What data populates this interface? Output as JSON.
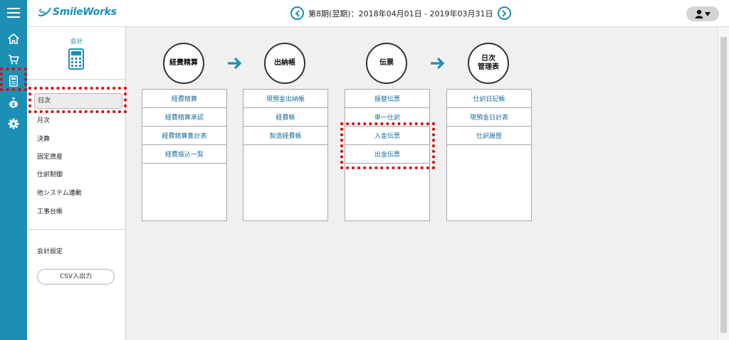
{
  "app": {
    "logo_text": "SmileWorks"
  },
  "header": {
    "period": "第8期(翌期)：2018年04月01日 - 2019年03月31日"
  },
  "rail": {
    "icons": [
      "menu-icon",
      "home-icon",
      "cart-icon",
      "calculator-icon",
      "yen-bag-icon",
      "gear-icon"
    ]
  },
  "sidebar": {
    "title": "会計",
    "items": [
      {
        "label": "日次",
        "active": true
      },
      {
        "label": "月次"
      },
      {
        "label": "決算"
      },
      {
        "label": "固定資産"
      },
      {
        "label": "仕訳制御"
      },
      {
        "label": "他システム連動"
      },
      {
        "label": "工事台帳"
      }
    ],
    "settings_label": "会計設定",
    "csv_label": "CSV入出力"
  },
  "flow": {
    "columns": [
      {
        "title": "経費精算",
        "items": [
          "経費精算",
          "経費精算承認",
          "経費精算集計表",
          "経費振込一覧"
        ]
      },
      {
        "title": "出納帳",
        "items": [
          "現預金出納帳",
          "経費帳",
          "製造経費帳"
        ]
      },
      {
        "title": "伝票",
        "items": [
          "振替伝票",
          "単一仕訳",
          "入金伝票",
          "出金伝票"
        ]
      },
      {
        "title_line1": "日次",
        "title_line2": "管理表",
        "items": [
          "仕訳日記帳",
          "現預金日計表",
          "仕訳履歴"
        ]
      }
    ]
  },
  "colors": {
    "rail": "#1d8fb4",
    "accent": "#1d8fb4",
    "highlight": "#e00000"
  }
}
